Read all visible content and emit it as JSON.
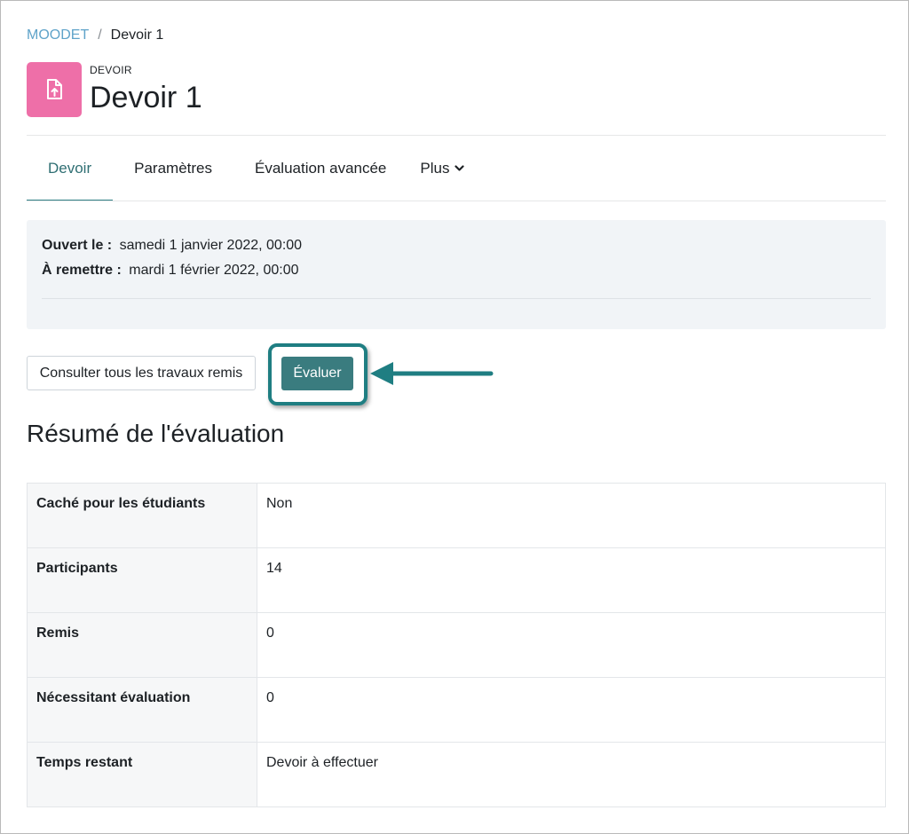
{
  "breadcrumb": {
    "course": "MOODET",
    "separator": "/",
    "current": "Devoir 1"
  },
  "header": {
    "icon": "assignment-upload-icon",
    "icon_color": "#ee6fa8",
    "activity_type": "DEVOIR",
    "title": "Devoir 1"
  },
  "tabs": [
    {
      "label": "Devoir",
      "active": true
    },
    {
      "label": "Paramètres",
      "active": false
    },
    {
      "label": "Évaluation avancée",
      "active": false
    },
    {
      "label": "Plus",
      "active": false,
      "has_dropdown": true
    }
  ],
  "dates": {
    "opened_label": "Ouvert le :",
    "opened_value": "samedi 1 janvier 2022, 00:00",
    "due_label": "À remettre :",
    "due_value": "mardi 1 février 2022, 00:00"
  },
  "actions": {
    "view_all_label": "Consulter tous les travaux remis",
    "grade_label": "Évaluer",
    "accent_color": "#3a7c7f",
    "highlight_color": "#1f7e82"
  },
  "summary": {
    "title": "Résumé de l'évaluation",
    "rows": [
      {
        "label": "Caché pour les étudiants",
        "value": "Non"
      },
      {
        "label": "Participants",
        "value": "14"
      },
      {
        "label": "Remis",
        "value": "0"
      },
      {
        "label": "Nécessitant évaluation",
        "value": "0"
      },
      {
        "label": "Temps restant",
        "value": "Devoir à effectuer"
      }
    ]
  }
}
